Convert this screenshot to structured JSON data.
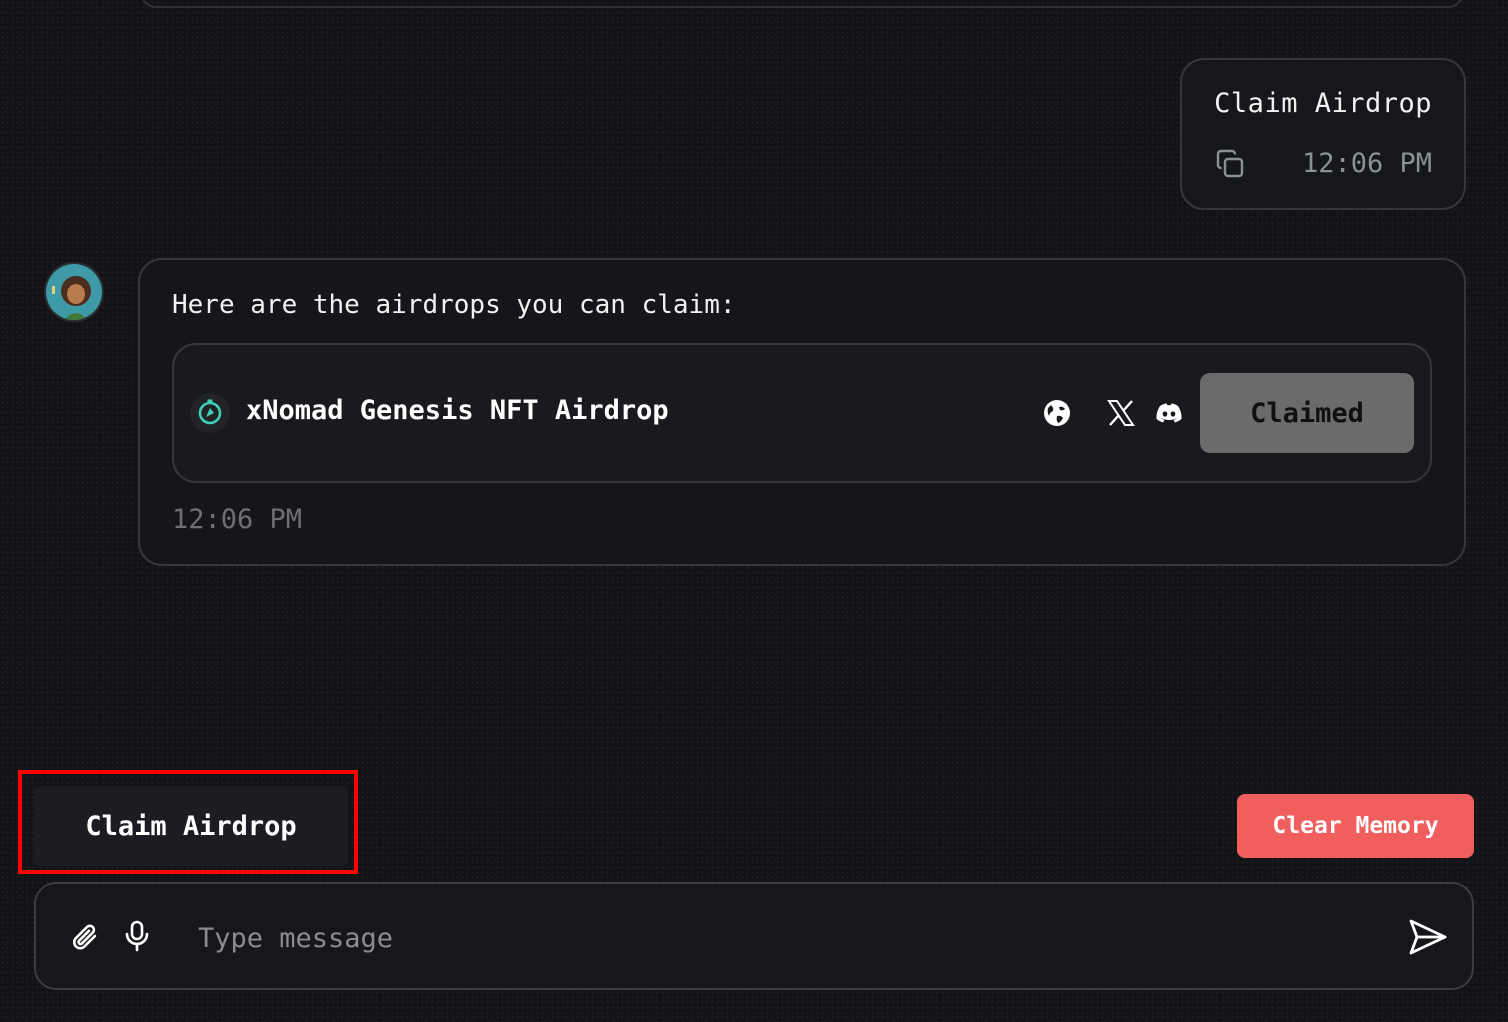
{
  "chat": {
    "user_message": {
      "text": "Claim Airdrop",
      "time": "12:06 PM"
    },
    "bot_message": {
      "text": "Here are the airdrops you can claim:",
      "time": "12:06 PM",
      "airdrop": {
        "name": "xNomad Genesis NFT Airdrop",
        "status_label": "Claimed",
        "links": [
          "globe-icon",
          "x-icon",
          "discord-icon"
        ]
      }
    }
  },
  "quick_actions": {
    "claim_airdrop_label": "Claim Airdrop"
  },
  "clear_memory_label": "Clear Memory",
  "composer": {
    "placeholder": "Type message",
    "value": ""
  },
  "colors": {
    "background": "#121316",
    "claimed_button": "#6b6b6c",
    "clear_memory": "#f15e5e",
    "highlight": "#ff0000",
    "logo_accent": "#3fd0b8"
  }
}
